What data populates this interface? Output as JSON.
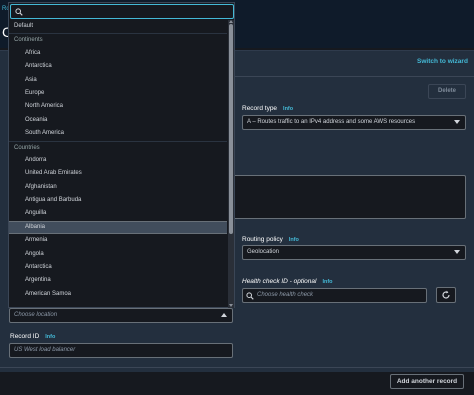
{
  "background": {
    "breadcrumb": "Ro",
    "page_title": "Cr",
    "switch_wizard": "Switch to wizard",
    "delete_label": "Delete",
    "record_type": {
      "label": "Record type",
      "info": "Info",
      "value": "A – Routes traffic to an IPv4 address and some AWS resources"
    },
    "routing_policy": {
      "label": "Routing policy",
      "info": "Info",
      "value": "Geolocation"
    },
    "health_check": {
      "label": "Health check ID - optional",
      "info": "Info",
      "placeholder": "Choose health check"
    },
    "add_record": "Add another record"
  },
  "form": {
    "location_placeholder": "Choose location",
    "record_id": {
      "label": "Record ID",
      "info": "Info",
      "placeholder": "US West load balancer"
    }
  },
  "dropdown": {
    "search_value": "",
    "default_option": "Default",
    "groups": [
      {
        "label": "Continents",
        "items": [
          "Africa",
          "Antarctica",
          "Asia",
          "Europe",
          "North America",
          "Oceania",
          "South America"
        ]
      },
      {
        "label": "Countries",
        "items": [
          "Andorra",
          "United Arab Emirates",
          "Afghanistan",
          "Antigua and Barbuda",
          "Anguilla",
          "Albania",
          "Armenia",
          "Angola",
          "Antarctica",
          "Argentina",
          "American Samoa"
        ]
      }
    ],
    "selected": "Albania"
  }
}
